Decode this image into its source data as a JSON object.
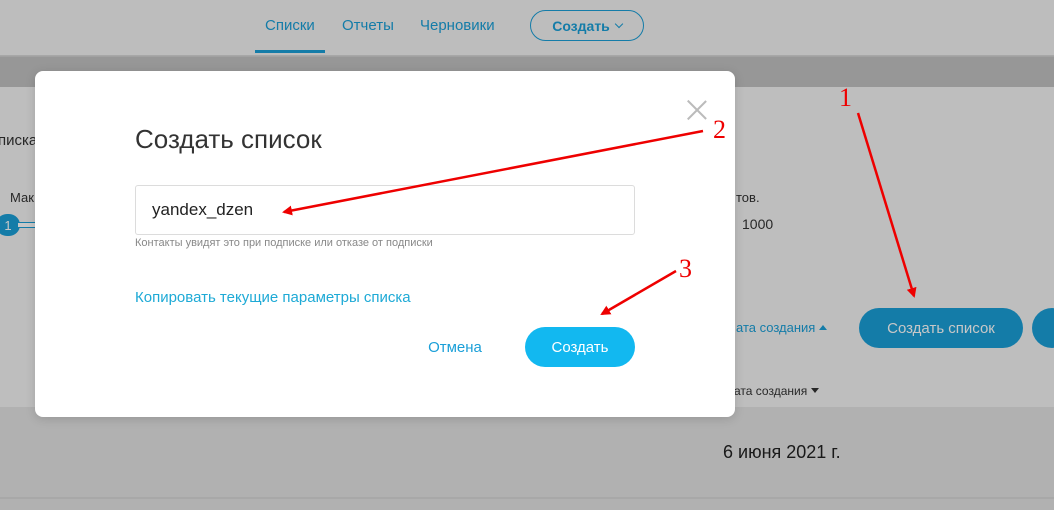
{
  "nav": {
    "tabs": [
      {
        "label": "Списки",
        "active": true
      },
      {
        "label": "Отчеты",
        "active": false
      },
      {
        "label": "Черновики",
        "active": false
      }
    ],
    "create_label": "Создать"
  },
  "background": {
    "lists_label_fragment": "писка",
    "max_label_fragment": "Мак",
    "slider_value": "1",
    "contacts_fragment": "тов.",
    "contacts_value": "1000",
    "sort_label_active": "ата создания",
    "sort_label_column": "ата создания",
    "create_list_button": "Создать список",
    "row_date": "6 июня 2021 г."
  },
  "modal": {
    "title": "Создать список",
    "input_value": "yandex_dzen",
    "hint": "Контакты увидят это при подписке или отказе от подписки",
    "copy_link": "Копировать текущие параметры списка",
    "cancel_label": "Отмена",
    "submit_label": "Создать"
  },
  "annotations": {
    "labels": [
      "1",
      "2",
      "3"
    ],
    "color": "#e00000"
  },
  "colors": {
    "accent": "#1a9fd8",
    "primary_button": "#12b8f0"
  }
}
